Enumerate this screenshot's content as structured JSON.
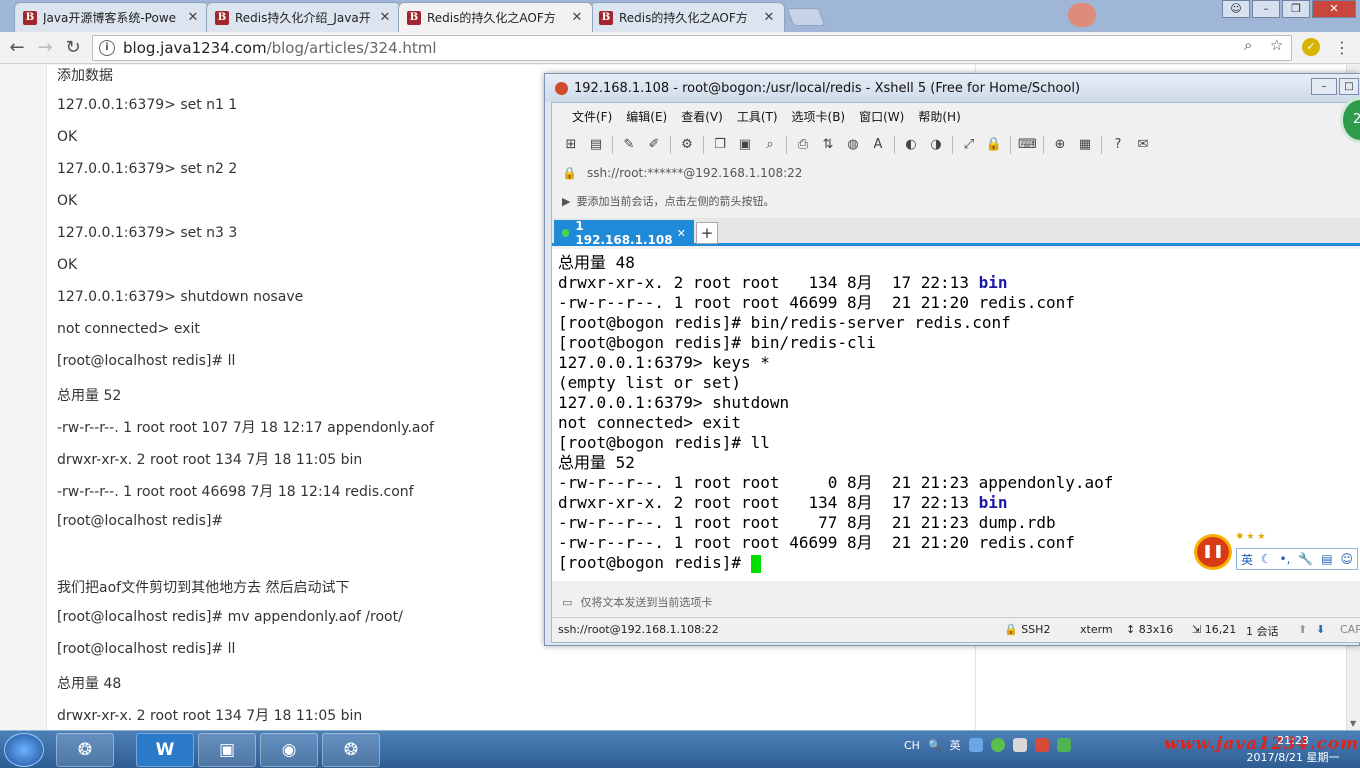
{
  "browser": {
    "tabs": [
      {
        "title": "Java开源博客系统-Powe",
        "active": false
      },
      {
        "title": "Redis持久化介绍_Java开",
        "active": false
      },
      {
        "title": "Redis的持久化之AOF方",
        "active": true
      },
      {
        "title": "Redis的持久化之AOF方",
        "active": false
      }
    ],
    "url_host": "blog.java1234.com",
    "url_path": "/blog/articles/324.html"
  },
  "article": {
    "lines": [
      "添加数据",
      "127.0.0.1:6379> set n1 1",
      "OK",
      "127.0.0.1:6379> set n2 2",
      "OK",
      "127.0.0.1:6379> set n3 3",
      "OK",
      "127.0.0.1:6379> shutdown nosave",
      "not connected> exit",
      "[root@localhost redis]# ll",
      "总用量 52",
      "-rw-r--r--. 1 root root   107 7月  18 12:17 appendonly.aof",
      "drwxr-xr-x. 2 root root   134 7月  18 11:05 bin",
      "-rw-r--r--. 1 root root 46698 7月  18 12:14 redis.conf",
      "[root@localhost redis]#",
      "我们把aof文件剪切到其他地方去 然后启动试下",
      "[root@localhost redis]# mv appendonly.aof /root/",
      "[root@localhost redis]# ll",
      "总用量 48",
      "drwxr-xr-x. 2 root root   134 7月  18 11:05 bin"
    ]
  },
  "xshell": {
    "title": "192.168.1.108 - root@bogon:/usr/local/redis - Xshell 5 (Free for Home/School)",
    "menu": [
      "文件(F)",
      "编辑(E)",
      "查看(V)",
      "工具(T)",
      "选项卡(B)",
      "窗口(W)",
      "帮助(H)"
    ],
    "address": "ssh://root:******@192.168.1.108:22",
    "hint": "要添加当前会话，点击左侧的箭头按钮。",
    "tab_label": "1 192.168.1.108",
    "send_bar": "仅将文本发送到当前选项卡",
    "status": {
      "conn": "ssh://root@192.168.1.108:22",
      "proto": "SSH2",
      "term": "xterm",
      "size": "83x16",
      "pos": "16,21",
      "sessions": "1 会话",
      "cap": "CAP"
    },
    "terminal": [
      {
        "text": "总用量 48"
      },
      {
        "text": "drwxr-xr-x. 2 root root   134 8月  17 22:13 ",
        "dir": "bin"
      },
      {
        "text": "-rw-r--r--. 1 root root 46699 8月  21 21:20 redis.conf"
      },
      {
        "text": "[root@bogon redis]# bin/redis-server redis.conf"
      },
      {
        "text": "[root@bogon redis]# bin/redis-cli"
      },
      {
        "text": "127.0.0.1:6379> keys *"
      },
      {
        "text": "(empty list or set)"
      },
      {
        "text": "127.0.0.1:6379> shutdown"
      },
      {
        "text": "not connected> exit"
      },
      {
        "text": "[root@bogon redis]# ll"
      },
      {
        "text": "总用量 52"
      },
      {
        "text": "-rw-r--r--. 1 root root     0 8月  21 21:23 appendonly.aof"
      },
      {
        "text": "drwxr-xr-x. 2 root root   134 8月  17 22:13 ",
        "dir": "bin"
      },
      {
        "text": "-rw-r--r--. 1 root root    77 8月  21 21:23 dump.rdb"
      },
      {
        "text": "-rw-r--r--. 1 root root 46699 8月  21 21:20 redis.conf"
      },
      {
        "text": "[root@bogon redis]# ",
        "cursor": true
      }
    ]
  },
  "widgets": {
    "badge": "21",
    "ime_label": "英"
  },
  "taskbar": {
    "tray_lang": "CH",
    "tray_ime": "英",
    "watermark": "www.java1234.com",
    "time": "21:23",
    "date": "2017/8/21 星期一"
  }
}
